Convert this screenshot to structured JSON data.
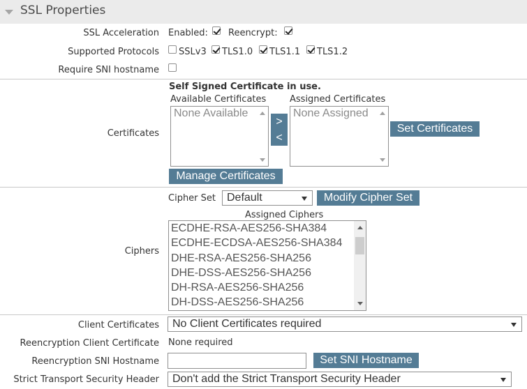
{
  "section": {
    "title": "SSL Properties"
  },
  "ssl_acceleration": {
    "label": "SSL Acceleration",
    "enabled_label": "Enabled:",
    "enabled_checked": true,
    "reencrypt_label": "Reencrypt:",
    "reencrypt_checked": true
  },
  "protocols": {
    "label": "Supported Protocols",
    "items": [
      {
        "name": "SSLv3",
        "checked": false
      },
      {
        "name": "TLS1.0",
        "checked": true
      },
      {
        "name": "TLS1.1",
        "checked": true
      },
      {
        "name": "TLS1.2",
        "checked": true
      }
    ]
  },
  "sni": {
    "label": "Require SNI hostname",
    "checked": false
  },
  "certificates": {
    "label": "Certificates",
    "notice": "Self Signed Certificate in use.",
    "available_header": "Available Certificates",
    "available_placeholder": "None Available",
    "assigned_header": "Assigned Certificates",
    "assigned_placeholder": "None Assigned",
    "move_right_label": ">",
    "move_left_label": "<",
    "set_button": "Set Certificates",
    "manage_button": "Manage Certificates"
  },
  "ciphers": {
    "label": "Ciphers",
    "cipher_set_label": "Cipher Set",
    "cipher_set_value": "Default",
    "modify_button": "Modify Cipher Set",
    "assigned_header": "Assigned Ciphers",
    "items": [
      "ECDHE-RSA-AES256-SHA384",
      "ECDHE-ECDSA-AES256-SHA384",
      "DHE-RSA-AES256-SHA256",
      "DHE-DSS-AES256-SHA256",
      "DH-RSA-AES256-SHA256",
      "DH-DSS-AES256-SHA256"
    ]
  },
  "client_certificates": {
    "label": "Client Certificates",
    "value": "No Client Certificates required"
  },
  "reencryption_client_certificate": {
    "label": "Reencryption Client Certificate",
    "value": "None required"
  },
  "reencryption_sni": {
    "label": "Reencryption SNI Hostname",
    "value": "",
    "button": "Set SNI Hostname"
  },
  "sts_header": {
    "label": "Strict Transport Security Header",
    "value": "Don't add the Strict Transport Security Header"
  },
  "colors": {
    "button": "#547c95",
    "header_bg": "#ebebeb",
    "divider": "#c8c8c8"
  }
}
